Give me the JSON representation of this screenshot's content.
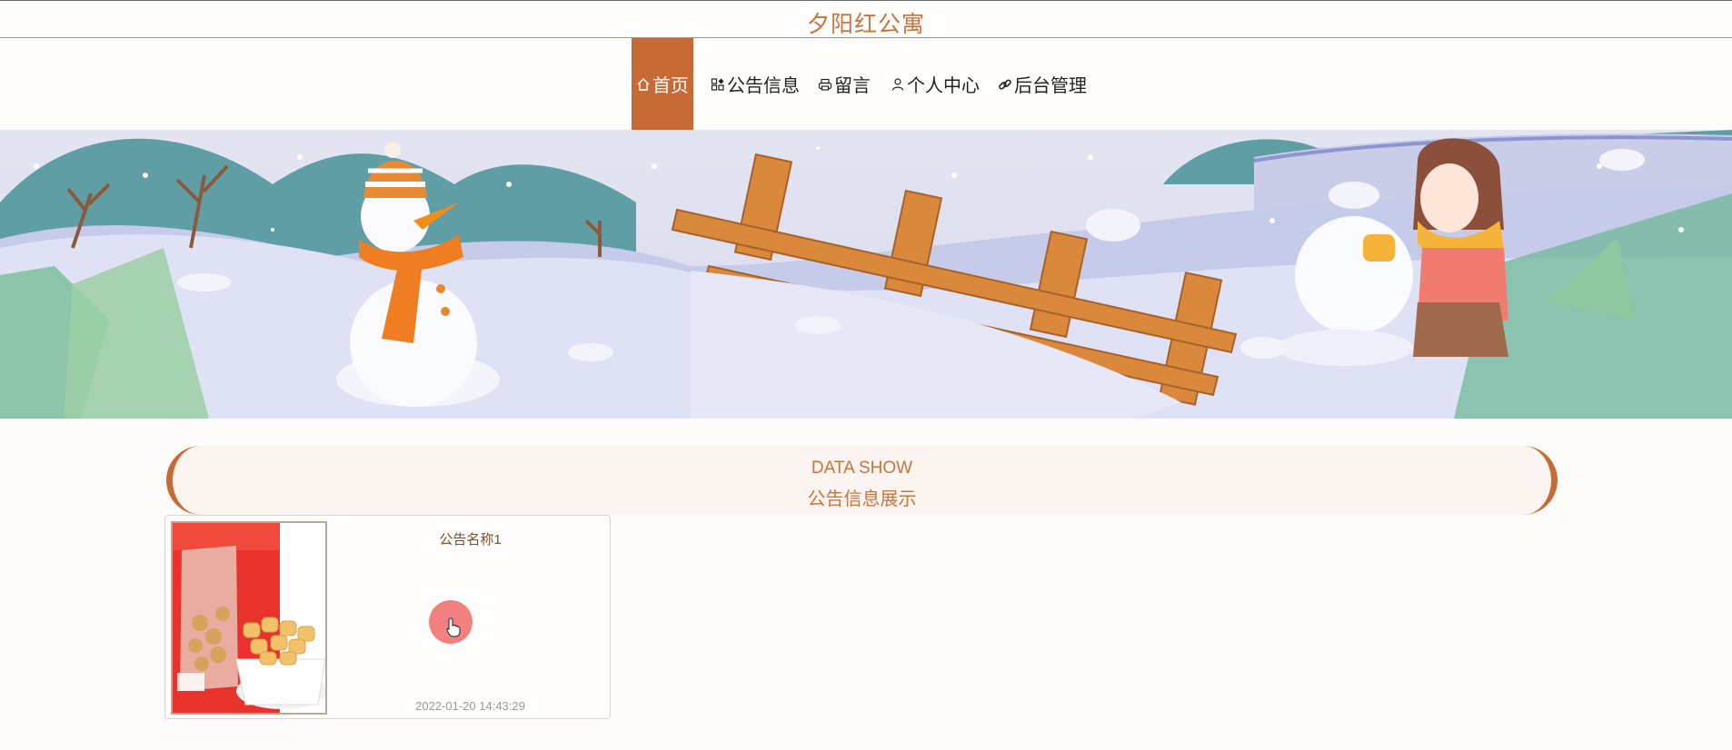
{
  "site": {
    "title": "夕阳红公寓"
  },
  "nav": {
    "items": [
      {
        "label": "首页",
        "icon": "home-icon",
        "active": true
      },
      {
        "label": "公告信息",
        "icon": "grid-icon",
        "active": false
      },
      {
        "label": "留言",
        "icon": "printer-icon",
        "active": false
      },
      {
        "label": "个人中心",
        "icon": "person-icon",
        "active": false
      },
      {
        "label": "后台管理",
        "icon": "link-icon",
        "active": false
      }
    ]
  },
  "carousel": {
    "slide_count": 2,
    "active_slide": 1
  },
  "section": {
    "title_en": "DATA SHOW",
    "title_zh": "公告信息展示"
  },
  "notices": [
    {
      "name": "公告名称1",
      "time": "2022-01-20 14:43:29"
    }
  ],
  "colors": {
    "accent": "#c76a35",
    "title_text": "#c9743f",
    "page_bg": "#fefcfb"
  }
}
